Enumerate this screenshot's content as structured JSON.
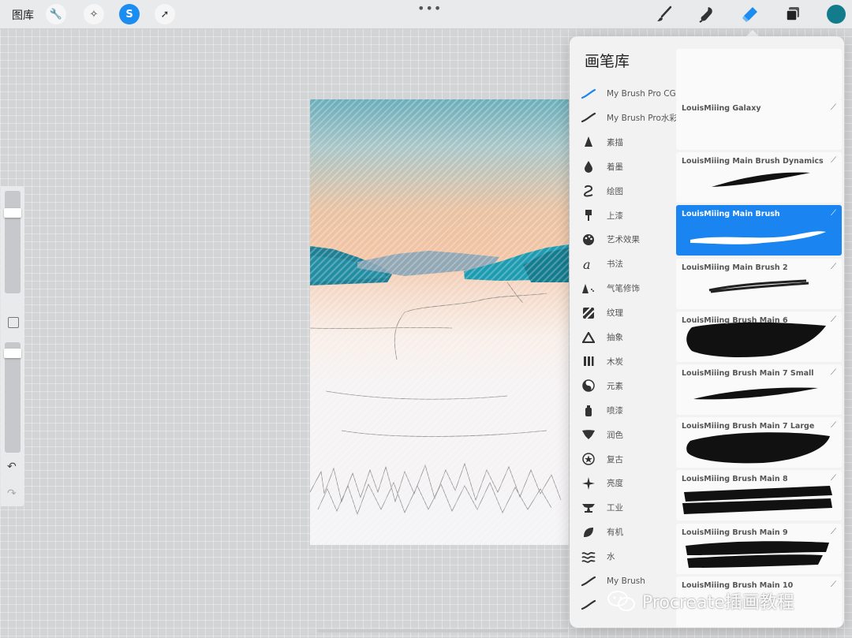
{
  "topbar": {
    "gallery_label": "图库",
    "left_tools": [
      {
        "icon": "wrench-icon",
        "glyph": "🔧",
        "active": false
      },
      {
        "icon": "magic-wand-icon",
        "glyph": "✧",
        "active": false
      },
      {
        "icon": "selection-s-icon",
        "glyph": "S",
        "active": true
      },
      {
        "icon": "transform-arrow-icon",
        "glyph": "➚",
        "active": false
      }
    ],
    "more_label": "•••",
    "right_tools": [
      "paint-brush-icon",
      "smudge-icon",
      "eraser-icon",
      "layers-icon"
    ],
    "active_tool": "eraser-icon",
    "current_color": "#137c8c"
  },
  "sidebar": {
    "undo_glyph": "↶",
    "redo_glyph": "↷"
  },
  "brush_library": {
    "title": "画笔库",
    "add_glyph": "+",
    "categories": [
      {
        "label": "My Brush Pro CG",
        "icon": "brush-stroke-icon"
      },
      {
        "label": "My Brush Pro水彩",
        "icon": "brush-stroke-icon"
      },
      {
        "label": "素描",
        "icon": "pencil-tip-icon"
      },
      {
        "label": "着墨",
        "icon": "ink-drop-icon"
      },
      {
        "label": "绘图",
        "icon": "squiggle-icon"
      },
      {
        "label": "上漆",
        "icon": "paint-brush-icon"
      },
      {
        "label": "艺术效果",
        "icon": "palette-icon"
      },
      {
        "label": "书法",
        "icon": "calligraphy-a-icon"
      },
      {
        "label": "气笔修饰",
        "icon": "airbrush-icon"
      },
      {
        "label": "纹理",
        "icon": "texture-icon"
      },
      {
        "label": "抽象",
        "icon": "triangle-icon"
      },
      {
        "label": "木炭",
        "icon": "charcoal-icon"
      },
      {
        "label": "元素",
        "icon": "yin-yang-icon"
      },
      {
        "label": "喷漆",
        "icon": "spray-can-icon"
      },
      {
        "label": "润色",
        "icon": "blend-icon"
      },
      {
        "label": "复古",
        "icon": "star-badge-icon"
      },
      {
        "label": "亮度",
        "icon": "sparkle-icon"
      },
      {
        "label": "工业",
        "icon": "anvil-icon"
      },
      {
        "label": "有机",
        "icon": "leaf-icon"
      },
      {
        "label": "水",
        "icon": "waves-icon"
      },
      {
        "label": "My Brush",
        "icon": "brush-stroke-icon"
      },
      {
        "label": "",
        "icon": "brush-stroke-icon"
      }
    ],
    "active_category_index": 0,
    "brushes": [
      {
        "name": "LouisMiiing Galaxy"
      },
      {
        "name": "LouisMiiing Main Brush Dynamics"
      },
      {
        "name": "LouisMiiing Main Brush"
      },
      {
        "name": "LouisMiiing Main Brush 2"
      },
      {
        "name": "LouisMiiing Brush Main 6"
      },
      {
        "name": "LouisMiiing Brush Main 7 Small"
      },
      {
        "name": "LouisMiiing Brush Main 7 Large"
      },
      {
        "name": "LouisMiiing Brush Main 8"
      },
      {
        "name": "LouisMiiing Brush Main 9"
      },
      {
        "name": "LouisMiiing Brush Main 10"
      }
    ],
    "selected_brush_index": 2
  },
  "watermark": {
    "text": "Procreate插画教程"
  }
}
